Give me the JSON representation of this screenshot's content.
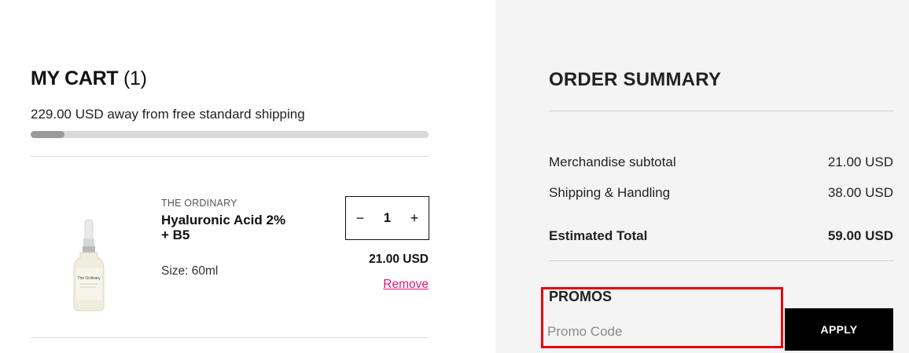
{
  "cart": {
    "title": "MY CART",
    "count": "(1)",
    "shipping_message": "229.00 USD away from free standard shipping",
    "shipping_progress_fraction": 0.084,
    "item": {
      "brand": "THE ORDINARY",
      "name": "Hyaluronic Acid 2% + B5",
      "size": "Size: 60ml",
      "quantity": "1",
      "decrement_icon": "minus-icon",
      "increment_icon": "plus-icon",
      "price": "21.00 USD",
      "remove_label": "Remove",
      "image_text": "The Ordinary"
    }
  },
  "summary": {
    "title": "ORDER SUMMARY",
    "rows": [
      {
        "label": "Merchandise subtotal",
        "value": "21.00 USD"
      },
      {
        "label": "Shipping & Handling",
        "value": "38.00 USD"
      }
    ],
    "total": {
      "label": "Estimated Total",
      "value": "59.00 USD"
    },
    "promos": {
      "title": "PROMOS",
      "placeholder": "Promo Code",
      "value": "",
      "apply_label": "APPLY"
    }
  },
  "colors": {
    "accent_link": "#e0137b",
    "highlight_box": "#e8000b",
    "summary_bg": "#f4f4f4"
  }
}
